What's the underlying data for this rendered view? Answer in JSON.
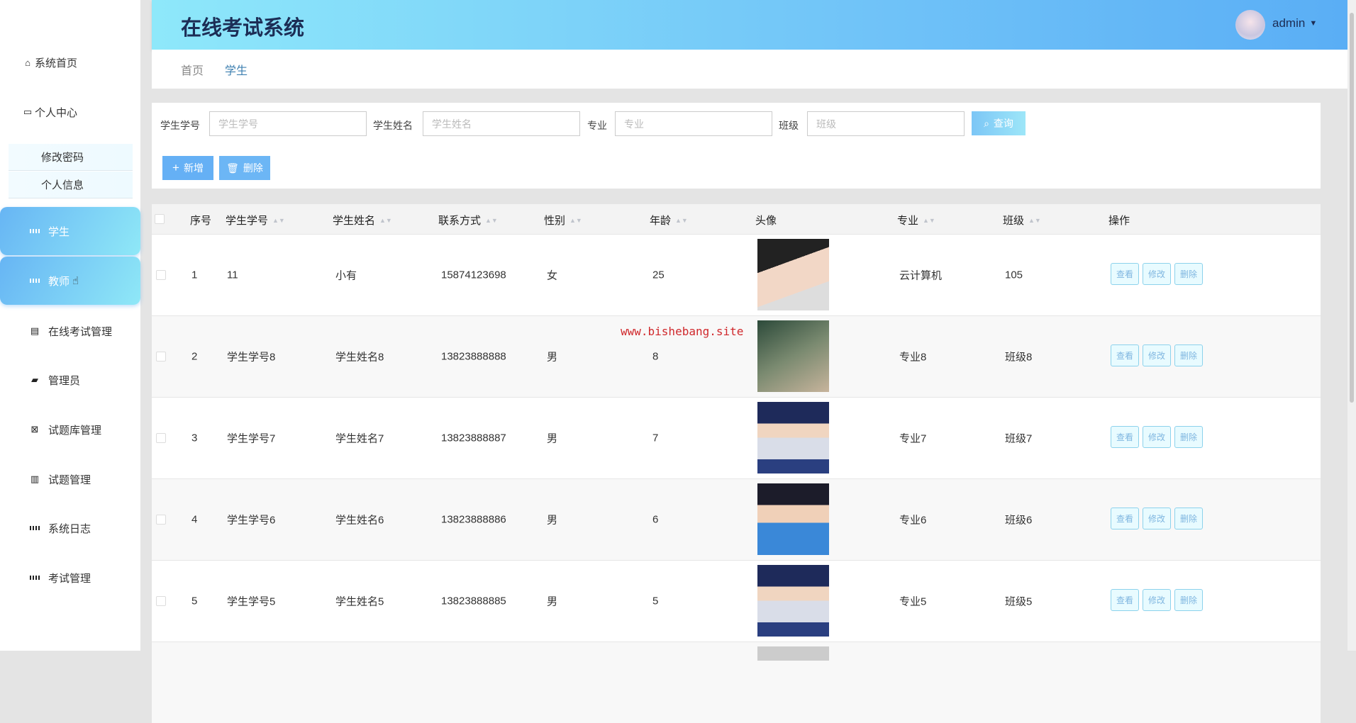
{
  "app": {
    "title": "在线考试系统",
    "user": "admin"
  },
  "breadcrumb": [
    "首页",
    "学生"
  ],
  "sidebar": {
    "items": [
      "系统首页",
      "个人中心",
      "修改密码",
      "个人信息",
      "学生",
      "教师",
      "在线考试管理",
      "管理员",
      "试题库管理",
      "试题管理",
      "系统日志",
      "考试管理"
    ]
  },
  "search": {
    "fields": [
      {
        "label": "学生学号",
        "placeholder": "学生学号"
      },
      {
        "label": "学生姓名",
        "placeholder": "学生姓名"
      },
      {
        "label": "专业",
        "placeholder": "专业"
      },
      {
        "label": "班级",
        "placeholder": "班级"
      }
    ],
    "query": "查询",
    "add": "新增",
    "delete": "删除"
  },
  "table": {
    "headers": [
      "序号",
      "学生学号",
      "学生姓名",
      "联系方式",
      "性别",
      "年龄",
      "头像",
      "专业",
      "班级",
      "操作"
    ],
    "rows": [
      [
        "1",
        "11",
        "小有",
        "15874123698",
        "女",
        "25",
        "云计算机",
        "105"
      ],
      [
        "2",
        "学生学号8",
        "学生姓名8",
        "13823888888",
        "男",
        "8",
        "专业8",
        "班级8"
      ],
      [
        "3",
        "学生学号7",
        "学生姓名7",
        "13823888887",
        "男",
        "7",
        "专业7",
        "班级7"
      ],
      [
        "4",
        "学生学号6",
        "学生姓名6",
        "13823888886",
        "男",
        "6",
        "专业6",
        "班级6"
      ],
      [
        "5",
        "学生学号5",
        "学生姓名5",
        "13823888885",
        "男",
        "5",
        "专业5",
        "班级5"
      ]
    ],
    "actions": [
      "查看",
      "修改",
      "删除"
    ]
  },
  "watermark": "www.bishebang.site",
  "colors": {
    "accent": "#5aaef5",
    "header_start": "#8ee8fa",
    "title": "#1c2d55",
    "watermark": "#d0282c"
  }
}
